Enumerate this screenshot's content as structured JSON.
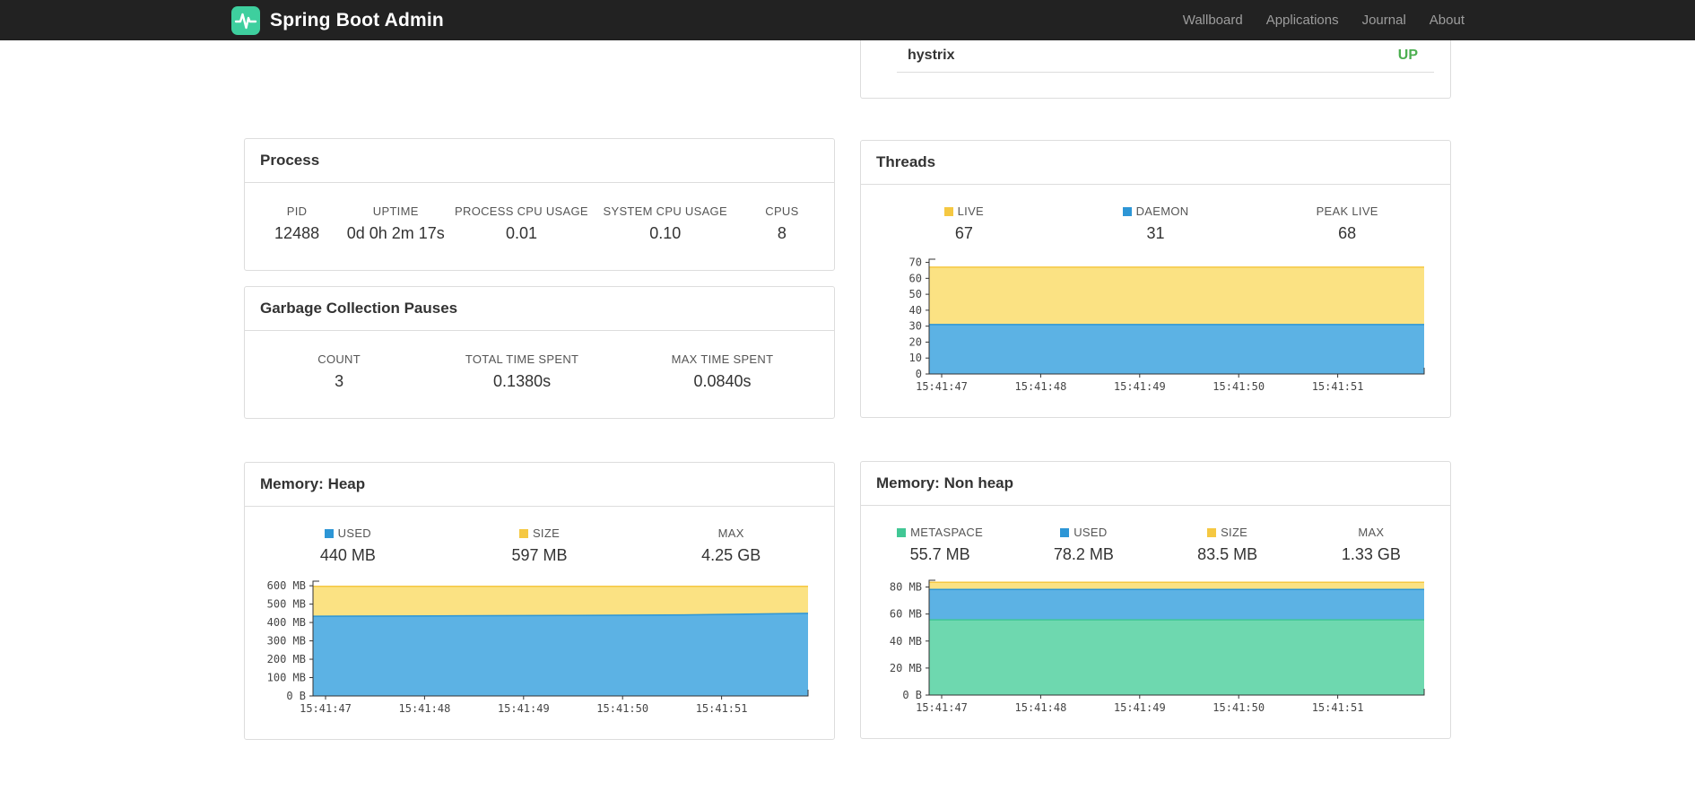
{
  "navbar": {
    "brand": "Spring Boot Admin",
    "links": [
      "Wallboard",
      "Applications",
      "Journal",
      "About"
    ]
  },
  "health": {
    "service": "hystrix",
    "status": "UP",
    "status_color": "#4caf50"
  },
  "panels": {
    "process": {
      "title": "Process",
      "stats": [
        {
          "label": "PID",
          "value": "12488"
        },
        {
          "label": "UPTIME",
          "value": "0d 0h 2m 17s"
        },
        {
          "label": "PROCESS CPU USAGE",
          "value": "0.01"
        },
        {
          "label": "SYSTEM CPU USAGE",
          "value": "0.10"
        },
        {
          "label": "CPUS",
          "value": "8"
        }
      ]
    },
    "gc": {
      "title": "Garbage Collection Pauses",
      "stats": [
        {
          "label": "COUNT",
          "value": "3"
        },
        {
          "label": "TOTAL TIME SPENT",
          "value": "0.1380s"
        },
        {
          "label": "MAX TIME SPENT",
          "value": "0.0840s"
        }
      ]
    },
    "threads": {
      "title": "Threads",
      "stats": [
        {
          "label": "LIVE",
          "value": "67",
          "swatch": "#f5c842"
        },
        {
          "label": "DAEMON",
          "value": "31",
          "swatch": "#2d96d6"
        },
        {
          "label": "PEAK LIVE",
          "value": "68"
        }
      ]
    },
    "heap": {
      "title": "Memory: Heap",
      "stats": [
        {
          "label": "USED",
          "value": "440 MB",
          "swatch": "#2d96d6"
        },
        {
          "label": "SIZE",
          "value": "597 MB",
          "swatch": "#f5c842"
        },
        {
          "label": "MAX",
          "value": "4.25 GB"
        }
      ]
    },
    "nonheap": {
      "title": "Memory: Non heap",
      "stats": [
        {
          "label": "METASPACE",
          "value": "55.7 MB",
          "swatch": "#41c795"
        },
        {
          "label": "USED",
          "value": "78.2 MB",
          "swatch": "#2d96d6"
        },
        {
          "label": "SIZE",
          "value": "83.5 MB",
          "swatch": "#f5c842"
        },
        {
          "label": "MAX",
          "value": "1.33 GB"
        }
      ]
    }
  },
  "chart_data": [
    {
      "id": "threads",
      "type": "area",
      "x_labels": [
        "15:41:47",
        "15:41:48",
        "15:41:49",
        "15:41:50",
        "15:41:51"
      ],
      "ylim": [
        0,
        72
      ],
      "yticks": [
        {
          "v": 0,
          "l": "0"
        },
        {
          "v": 10,
          "l": "10"
        },
        {
          "v": 20,
          "l": "20"
        },
        {
          "v": 30,
          "l": "30"
        },
        {
          "v": 40,
          "l": "40"
        },
        {
          "v": 50,
          "l": "50"
        },
        {
          "v": 60,
          "l": "60"
        },
        {
          "v": 70,
          "l": "70"
        }
      ],
      "legend": [
        "LIVE",
        "DAEMON"
      ],
      "series": [
        {
          "name": "LIVE",
          "color": "#f5c842",
          "fill": "#fbe283",
          "values": [
            67,
            67,
            67,
            67,
            67
          ]
        },
        {
          "name": "DAEMON",
          "color": "#2d96d6",
          "fill": "#5cb2e4",
          "values": [
            31,
            31,
            31,
            31,
            31
          ]
        }
      ]
    },
    {
      "id": "heap",
      "type": "area",
      "x_labels": [
        "15:41:47",
        "15:41:48",
        "15:41:49",
        "15:41:50",
        "15:41:51"
      ],
      "ylim": [
        0,
        625
      ],
      "yticks": [
        {
          "v": 0,
          "l": "0 B"
        },
        {
          "v": 100,
          "l": "100 MB"
        },
        {
          "v": 200,
          "l": "200 MB"
        },
        {
          "v": 300,
          "l": "300 MB"
        },
        {
          "v": 400,
          "l": "400 MB"
        },
        {
          "v": 500,
          "l": "500 MB"
        },
        {
          "v": 600,
          "l": "600 MB"
        }
      ],
      "legend": [
        "SIZE",
        "USED"
      ],
      "series": [
        {
          "name": "SIZE",
          "color": "#f5c842",
          "fill": "#fbe283",
          "values": [
            597,
            597,
            597,
            597,
            597
          ]
        },
        {
          "name": "USED",
          "color": "#2d96d6",
          "fill": "#5cb2e4",
          "values": [
            434,
            436,
            438,
            441,
            450
          ]
        }
      ]
    },
    {
      "id": "nonheap",
      "type": "area",
      "x_labels": [
        "15:41:47",
        "15:41:48",
        "15:41:49",
        "15:41:50",
        "15:41:51"
      ],
      "ylim": [
        0,
        85
      ],
      "yticks": [
        {
          "v": 0,
          "l": "0 B"
        },
        {
          "v": 20,
          "l": "20 MB"
        },
        {
          "v": 40,
          "l": "40 MB"
        },
        {
          "v": 60,
          "l": "60 MB"
        },
        {
          "v": 80,
          "l": "80 MB"
        }
      ],
      "legend": [
        "SIZE",
        "USED",
        "METASPACE"
      ],
      "series": [
        {
          "name": "SIZE",
          "color": "#f5c842",
          "fill": "#fbe283",
          "values": [
            83.5,
            83.5,
            83.5,
            83.5,
            83.5
          ]
        },
        {
          "name": "USED",
          "color": "#2d96d6",
          "fill": "#5cb2e4",
          "values": [
            78.2,
            78.2,
            78.2,
            78.2,
            78.2
          ]
        },
        {
          "name": "METASPACE",
          "color": "#41c795",
          "fill": "#6ed8af",
          "values": [
            55.7,
            55.7,
            55.7,
            55.7,
            55.7
          ]
        }
      ]
    }
  ]
}
